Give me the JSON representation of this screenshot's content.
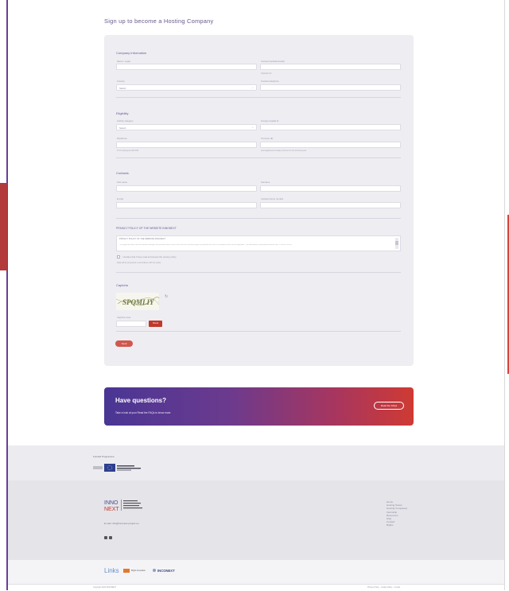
{
  "page_title": "Sign up to become a Hosting Company",
  "company_info": {
    "title": "Company Information",
    "fields": [
      {
        "label": "Name / Legal",
        "value": ""
      },
      {
        "label": "Contact (website/social)",
        "value": "",
        "hint": "Optional info"
      },
      {
        "label": "Country",
        "value": "Select"
      },
      {
        "label": "Contact telephone",
        "value": ""
      }
    ]
  },
  "eligibility": {
    "title": "Eligibility",
    "fields": [
      {
        "label": "Activity category",
        "value": "Select"
      },
      {
        "label": "Foreign Capital %",
        "value": ""
      },
      {
        "label": "Workforce",
        "value": "",
        "hint": "% of employees with PhD"
      },
      {
        "label": "Turnover (€)",
        "value": "",
        "hint": "Last registered company turnover in the previous year"
      }
    ]
  },
  "contacts": {
    "title": "Contacts",
    "fields": [
      {
        "label": "First name",
        "value": ""
      },
      {
        "label": "Surname",
        "value": ""
      },
      {
        "label": "E-mail",
        "value": ""
      },
      {
        "label": "Contact phone number",
        "value": ""
      }
    ]
  },
  "privacy": {
    "title": "PRIVACY POLICY OF THE WEBSITE INNONEXT",
    "box_heading": "PRIVACY POLICY OF THE WEBSITE INNONEXT",
    "box_text": "This page describes how the website manages the personal data of users who consult it and what rights are granted to users in accordance with current legislation. The information is provided pursuant to Art. 13 of the GDPR.",
    "checkbox_label": "I declare that I have read and accept the privacy policy",
    "note": "Data will be processed in accordance with the policy"
  },
  "captcha": {
    "title": "Captcha",
    "code": "SPQMLIY",
    "input_label": "Captcha code",
    "input_value": "",
    "check_label": "Check"
  },
  "submit_label": "Send",
  "cta": {
    "title": "Have questions?",
    "subtitle": "Take a look at your Read the FAQs to know more",
    "button": "Read the FAQs"
  },
  "funding": {
    "title": "Funded Programme"
  },
  "footer": {
    "email": "E-mail: info@innonext-project.eu",
    "links": [
      "Home",
      "Hosting Teams",
      "Hosting Companies",
      "Internship",
      "Resources",
      "FAQ",
      "Contact",
      "Rights"
    ]
  },
  "partners": [
    "Links",
    "Bright Innovation",
    "INCONEXT"
  ],
  "bottom": {
    "left": "Copyright 2024 INNONEXT",
    "right": "Privacy Policy · Cookie Policy · Credits"
  },
  "colors": {
    "accent": "#c0392b",
    "brand_purple": "#6b5a8e",
    "form_bg": "#ededf2"
  }
}
